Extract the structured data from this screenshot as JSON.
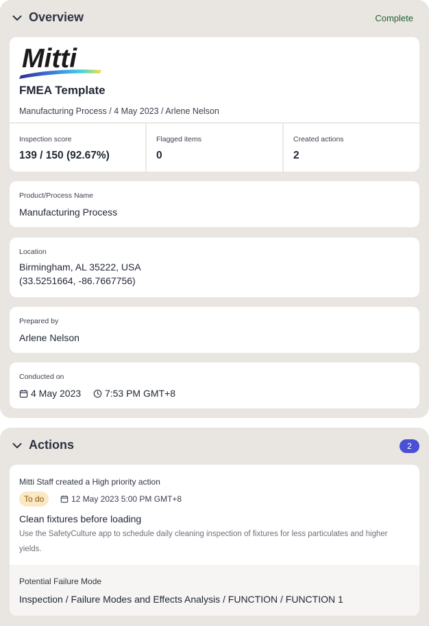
{
  "overview": {
    "title": "Overview",
    "status": "Complete",
    "logo_text": "Mitti",
    "template_title": "FMEA Template",
    "meta_line": "Manufacturing Process / 4 May 2023 / Arlene Nelson",
    "stats": [
      {
        "label": "Inspection score",
        "value": "139 / 150 (92.67%)"
      },
      {
        "label": "Flagged items",
        "value": "0"
      },
      {
        "label": "Created actions",
        "value": "2"
      }
    ],
    "fields": {
      "product": {
        "label": "Product/Process Name",
        "value": "Manufacturing Process"
      },
      "location": {
        "label": "Location",
        "line1": "Birmingham, AL 35222, USA",
        "line2": "(33.5251664, -86.7667756)"
      },
      "prepared_by": {
        "label": "Prepared by",
        "value": "Arlene Nelson"
      },
      "conducted_on": {
        "label": "Conducted on",
        "date": "4 May 2023",
        "time": "7:53 PM GMT+8"
      }
    }
  },
  "actions": {
    "title": "Actions",
    "count": "2",
    "item": {
      "intro": "Mitti Staff created a High priority action",
      "status": "To do",
      "due": "12 May 2023 5:00 PM GMT+8",
      "title": "Clean fixtures before loading",
      "description": "Use the SafetyCulture app to schedule daily cleaning inspection of fixtures for less particulates and higher yields.",
      "failure_label": "Potential Failure Mode",
      "failure_value": "Inspection / Failure Modes and Effects Analysis / FUNCTION / FUNCTION 1"
    }
  },
  "colors": {
    "section_bg": "#e9e6e1",
    "card_bg": "#ffffff",
    "badge_purple": "#4b4fd3",
    "complete_green": "#1f5f2f",
    "todo_bg": "#fbe8c4"
  },
  "icons": [
    "chevron-down-icon",
    "calendar-icon",
    "clock-icon"
  ]
}
